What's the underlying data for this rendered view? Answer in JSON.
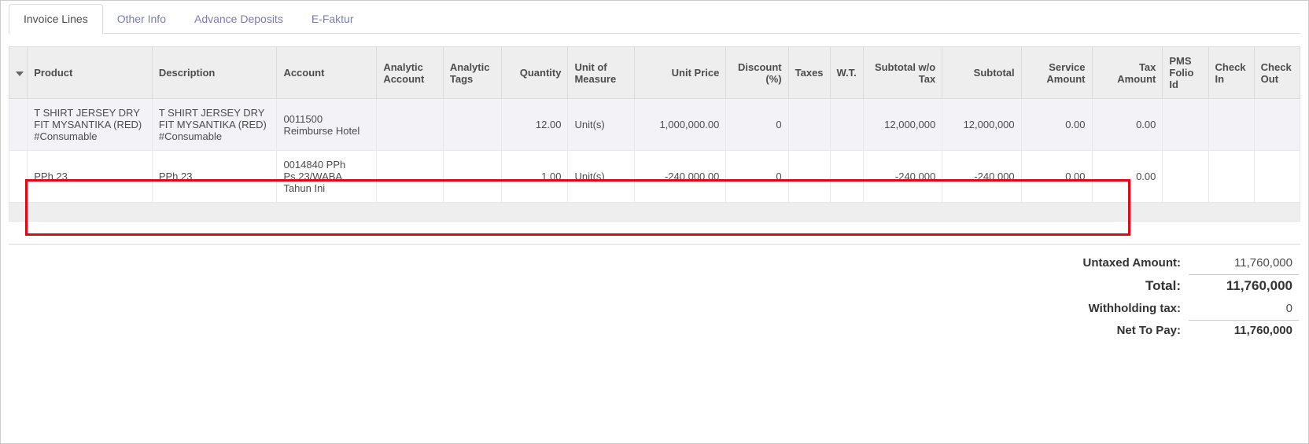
{
  "tabs": [
    {
      "label": "Invoice Lines",
      "active": true
    },
    {
      "label": "Other Info",
      "active": false
    },
    {
      "label": "Advance Deposits",
      "active": false
    },
    {
      "label": "E-Faktur",
      "active": false
    }
  ],
  "columns": {
    "product": "Product",
    "description": "Description",
    "account": "Account",
    "analytic_account": "Analytic Account",
    "analytic_tags": "Analytic Tags",
    "quantity": "Quantity",
    "uom": "Unit of Measure",
    "unit_price": "Unit Price",
    "discount": "Discount (%)",
    "taxes": "Taxes",
    "wt": "W.T.",
    "subtotal_wo_tax": "Subtotal w/o Tax",
    "subtotal": "Subtotal",
    "service_amount": "Service Amount",
    "tax_amount": "Tax Amount",
    "pms_folio": "PMS Folio Id",
    "check_in": "Check In",
    "check_out": "Check Out"
  },
  "rows": [
    {
      "product": "T SHIRT JERSEY DRY FIT MYSANTIKA (RED) #Consumable",
      "description": "T SHIRT JERSEY DRY FIT MYSANTIKA (RED) #Consumable",
      "account": "0011500 Reimburse Hotel",
      "analytic_account": "",
      "analytic_tags": "",
      "quantity": "12.00",
      "uom": "Unit(s)",
      "unit_price": "1,000,000.00",
      "discount": "0",
      "taxes": "",
      "wt": "",
      "subtotal_wo_tax": "12,000,000",
      "subtotal": "12,000,000",
      "service_amount": "0.00",
      "tax_amount": "0.00",
      "pms_folio": "",
      "check_in": "",
      "check_out": ""
    },
    {
      "product": "PPh 23",
      "description": "PPh 23",
      "account": "0014840 PPh Ps.23/WABA Tahun Ini",
      "analytic_account": "",
      "analytic_tags": "",
      "quantity": "1.00",
      "uom": "Unit(s)",
      "unit_price": "-240,000.00",
      "discount": "0",
      "taxes": "",
      "wt": "",
      "subtotal_wo_tax": "-240,000",
      "subtotal": "-240,000",
      "service_amount": "0.00",
      "tax_amount": "0.00",
      "pms_folio": "",
      "check_in": "",
      "check_out": ""
    }
  ],
  "summary": {
    "untaxed_label": "Untaxed Amount:",
    "untaxed_value": "11,760,000",
    "total_label": "Total:",
    "total_value": "11,760,000",
    "wt_label": "Withholding tax:",
    "wt_value": "0",
    "net_label": "Net To Pay:",
    "net_value": "11,760,000"
  }
}
